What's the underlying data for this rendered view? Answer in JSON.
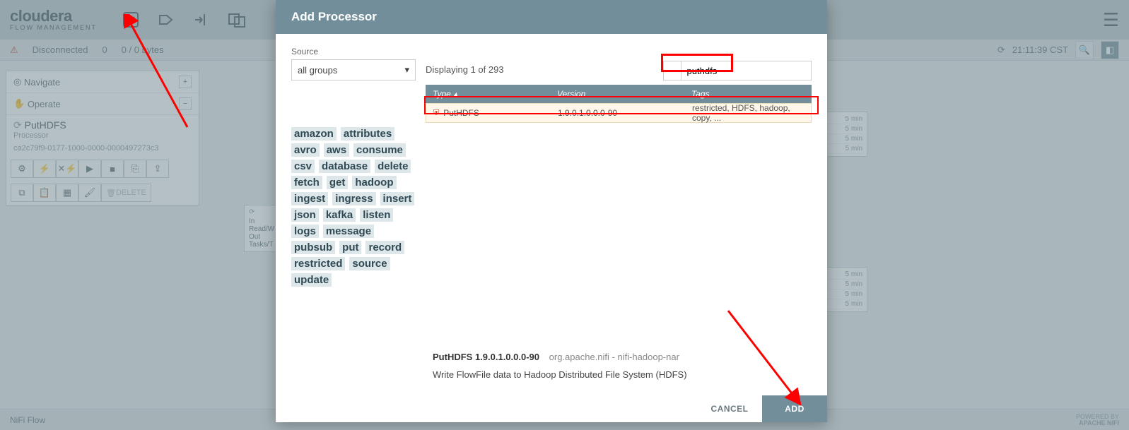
{
  "brand": {
    "name": "cloudera",
    "sub": "FLOW MANAGEMENT"
  },
  "statusbar": {
    "conn_status": "Disconnected",
    "count": "0",
    "bytes": "0 / 0 bytes",
    "time": "21:11:39 CST"
  },
  "side": {
    "navigate": "Navigate",
    "operate": "Operate",
    "proc_name": "PutHDFS",
    "proc_type": "Processor",
    "proc_id": "ca2c79f9-0177-1000-0000-0000497273c3",
    "delete": "DELETE"
  },
  "canvas_box": {
    "l1": "In",
    "l2": "Read/W",
    "l3": "Out",
    "l4": "Tasks/T"
  },
  "canvas_right": [
    "5 min",
    "5 min",
    "5 min",
    "5 min",
    "5 min",
    "5 min",
    "5 min",
    "5 min"
  ],
  "footer": {
    "flow": "NiFi Flow",
    "powered1": "POWERED BY",
    "powered2": "APACHE NIFI"
  },
  "dialog": {
    "title": "Add Processor",
    "source_label": "Source",
    "source_value": "all groups",
    "display": "Displaying 1 of 293",
    "search": "puthdfs",
    "headers": {
      "type": "Type",
      "version": "Version",
      "tags": "Tags"
    },
    "row": {
      "type": "PutHDFS",
      "version": "1.9.0.1.0.0.0-90",
      "tags": "restricted, HDFS, hadoop, copy, ..."
    },
    "tag_cloud": [
      "amazon",
      "attributes",
      "avro",
      "aws",
      "consume",
      "csv",
      "database",
      "delete",
      "fetch",
      "get",
      "hadoop",
      "ingest",
      "ingress",
      "insert",
      "json",
      "kafka",
      "listen",
      "logs",
      "message",
      "pubsub",
      "put",
      "record",
      "restricted",
      "source",
      "update"
    ],
    "selected_title": "PutHDFS 1.9.0.1.0.0.0-90",
    "selected_bundle": "org.apache.nifi - nifi-hadoop-nar",
    "selected_desc": "Write FlowFile data to Hadoop Distributed File System (HDFS)",
    "cancel": "CANCEL",
    "add": "ADD"
  }
}
